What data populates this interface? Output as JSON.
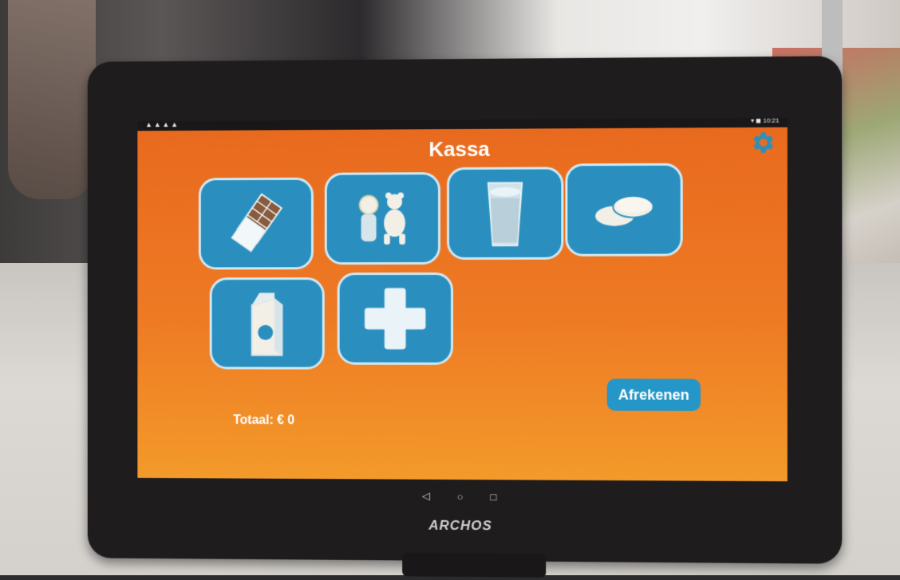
{
  "app": {
    "title": "Kassa",
    "settings_icon": "gear-icon"
  },
  "statusbar": {
    "left_icons": "▲▲▲▲",
    "right_text": "▾ ◼ 10:21"
  },
  "products": [
    {
      "name": "chocolate",
      "icon": "chocolate-bar-icon"
    },
    {
      "name": "toys",
      "icon": "doll-and-teddy-bear-icon"
    },
    {
      "name": "drink",
      "icon": "glass-icon"
    },
    {
      "name": "biscuits",
      "icon": "cookies-icon"
    },
    {
      "name": "juice",
      "icon": "juice-carton-icon"
    },
    {
      "name": "add",
      "icon": "plus-icon"
    }
  ],
  "checkout": {
    "label": "Afrekenen"
  },
  "total": {
    "label": "Totaal: € 0"
  },
  "navbar": {
    "back": "◁",
    "home": "○",
    "recents": "□"
  },
  "device": {
    "brand": "ARCHOS"
  },
  "colors": {
    "tile": "#2a8fbf",
    "tile_border": "#cfe8f2",
    "screen": "#ee7a24",
    "button": "#2496c7"
  }
}
